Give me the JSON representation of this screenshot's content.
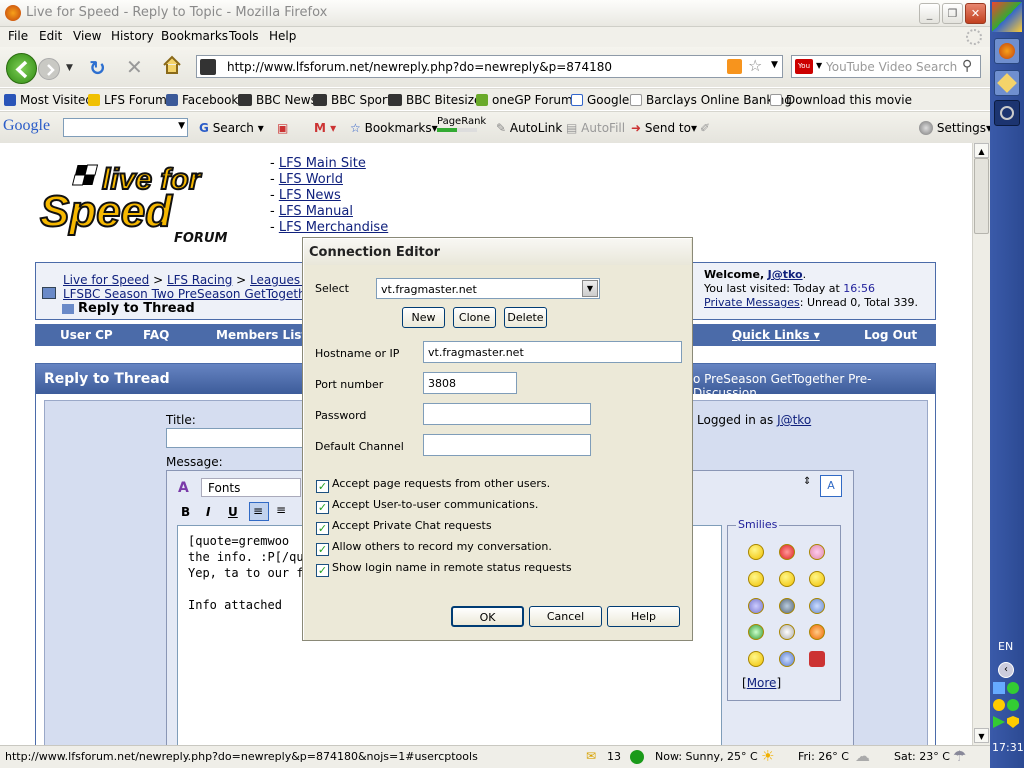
{
  "window": {
    "title": "Live for Speed - Reply to Topic - Mozilla Firefox"
  },
  "menu": [
    "File",
    "Edit",
    "View",
    "History",
    "Bookmarks",
    "Tools",
    "Help"
  ],
  "nav": {
    "url": "http://www.lfsforum.net/newreply.php?do=newreply&p=874180",
    "search_placeholder": "YouTube Video Search"
  },
  "bookmarks": [
    "Most Visited",
    "LFS Forum",
    "Facebook",
    "BBC News",
    "BBC Sport",
    "BBC Bitesize",
    "oneGP Forums",
    "Google",
    "Barclays Online Banking",
    "Download this movie"
  ],
  "google_bar": {
    "logo": "Google",
    "search": "Search",
    "bookmarks": "Bookmarks",
    "pagerank": "PageRank",
    "autolink": "AutoLink",
    "autofill": "AutoFill",
    "sendto": "Send to",
    "settings": "Settings"
  },
  "forum": {
    "logo_line1": "live for",
    "logo_line2": "Speed",
    "logo_sub": "FORUM",
    "links": [
      "LFS Main Site",
      "LFS World",
      "LFS News",
      "LFS Manual",
      "LFS Merchandise"
    ],
    "breadcrumb": [
      "Live for Speed",
      "LFS Racing",
      "Leagues &"
    ],
    "thread_crumb": "LFSBC Season Two PreSeason GetTogeth",
    "page_title": "Reply to Thread",
    "welcome_prefix": "Welcome,",
    "user": "J@tko",
    "last_visit_prefix": "You last visited: Today at",
    "last_visit_time": "16:56",
    "pm_link": "Private Messages",
    "pm_status": ": Unread 0, Total 339.",
    "navbar": [
      "User CP",
      "FAQ",
      "Members List",
      "Quick Links",
      "Log Out"
    ],
    "reply_header": "Reply to Thread",
    "reply_header_right": "o PreSeason GetTogether Pre-Discussion",
    "title_label": "Title:",
    "logged_in_prefix": "Logged in as",
    "message_label": "Message:",
    "font_select": "Fonts",
    "editor_lines": [
      "[quote=gremwoo",
      "the info. :P[/quo",
      "Yep, ta to our fri",
      "",
      "Info attached"
    ],
    "smilies_label": "Smilies",
    "more_link": "More"
  },
  "dialog": {
    "title": "Connection Editor",
    "select_label": "Select",
    "select_value": "vt.fragmaster.net",
    "btn_new": "New",
    "btn_clone": "Clone",
    "btn_delete": "Delete",
    "host_label": "Hostname or IP",
    "host_value": "vt.fragmaster.net",
    "port_label": "Port number",
    "port_value": "3808",
    "password_label": "Password",
    "channel_label": "Default Channel",
    "checks": [
      "Accept page requests from other users.",
      "Accept User-to-user communications.",
      "Accept Private Chat requests",
      "Allow others to record my conversation.",
      "Show login name in remote status requests"
    ],
    "btn_ok": "OK",
    "btn_cancel": "Cancel",
    "btn_help": "Help"
  },
  "status": {
    "url": "http://www.lfsforum.net/newreply.php?do=newreply&p=874180&nojs=1#usercptools",
    "mail_count": "13",
    "weather_now": "Now: Sunny, 25° C",
    "weather_fri": "Fri: 26° C",
    "weather_sat": "Sat: 23° C"
  },
  "tray": {
    "lang": "EN",
    "clock": "17:31"
  }
}
